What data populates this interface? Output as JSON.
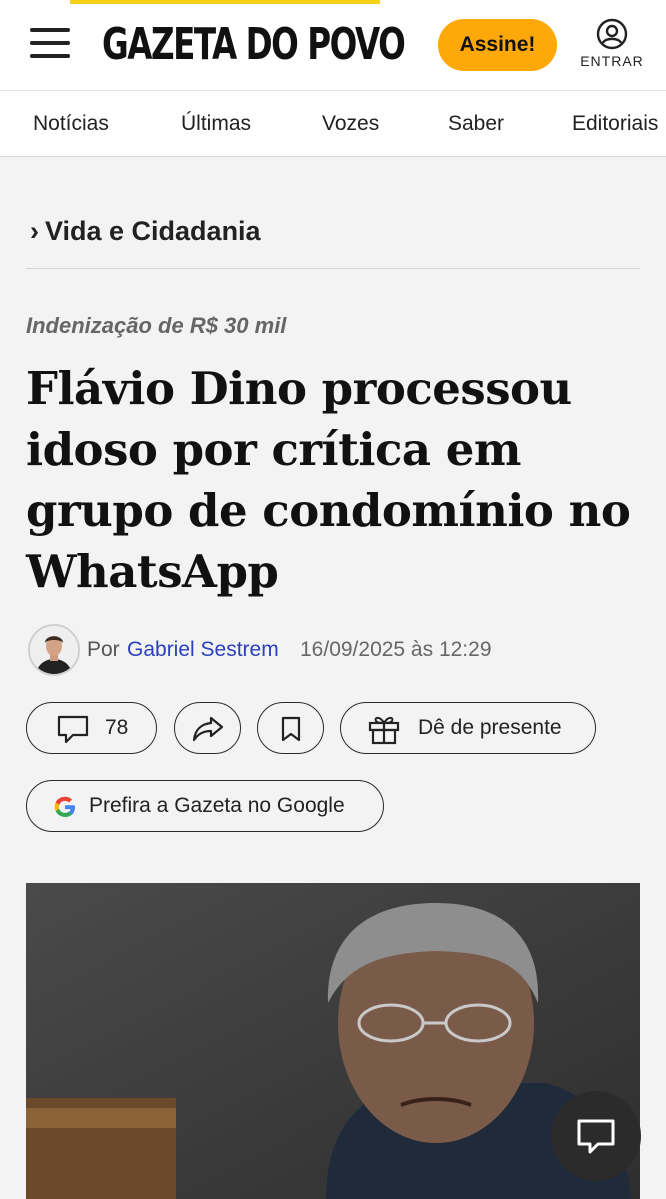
{
  "header": {
    "logo_text": "GAZETA DO POVO",
    "subscribe_label": "Assine!",
    "account_label": "ENTRAR"
  },
  "nav": {
    "items": [
      "Notícias",
      "Últimas",
      "Vozes",
      "Saber",
      "Editoriais"
    ]
  },
  "breadcrumb": {
    "section": "Vida e Cidadania"
  },
  "article": {
    "kicker": "Indenização de R$ 30 mil",
    "headline": "Flávio Dino processou idoso por crítica em grupo de condomínio no WhatsApp",
    "byline_prefix": "Por",
    "author": "Gabriel Sestrem",
    "date": "16/09/2025 às 12:29"
  },
  "actions": {
    "comments_count": "78",
    "gift_label": "Dê de presente",
    "google_label": "Prefira a Gazeta no Google"
  },
  "colors": {
    "accent": "#ffa80a",
    "author_link": "#2a3fbf"
  },
  "icons": {
    "menu": "hamburger-icon",
    "account": "user-circle-icon",
    "comments": "speech-bubble-icon",
    "share": "share-arrow-icon",
    "save": "bookmark-icon",
    "gift": "gift-icon",
    "google": "google-g-icon",
    "chat": "chat-bubble-icon"
  }
}
